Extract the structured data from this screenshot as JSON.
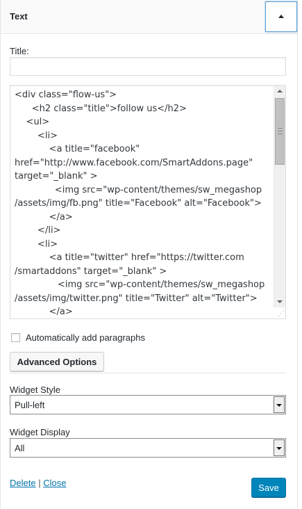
{
  "widget": {
    "title": "Text"
  },
  "form": {
    "title_label": "Title:",
    "title_value": "",
    "content_lines": [
      "<div class=\"flow-us\">",
      "      <h2 class=\"title\">follow us</h2>",
      "    <ul>",
      "        <li>",
      "            <a title=\"facebook\"",
      "href=\"http://www.facebook.com/SmartAddons.page\"",
      "target=\"_blank\" >",
      "              <img src=\"wp-content/themes/sw_megashop",
      "/assets/img/fb.png\" title=\"Facebook\" alt=\"Facebook\">",
      "            </a>",
      "        </li>",
      "        <li>",
      "            <a title=\"twitter\" href=\"https://twitter.com",
      "/smartaddons\" target=\"_blank\" >",
      "               <img src=\"wp-content/themes/sw_megashop",
      "/assets/img/twitter.png\" title=\"Twitter\" alt=\"Twitter\">",
      "            </a>"
    ],
    "autop_label": "Automatically add paragraphs",
    "autop_checked": false,
    "advanced_button": "Advanced Options",
    "style_label": "Widget Style",
    "style_value": "Pull-left",
    "display_label": "Widget Display",
    "display_value": "All"
  },
  "footer": {
    "delete_label": "Delete",
    "separator": "|",
    "close_label": "Close",
    "save_label": "Save"
  },
  "colors": {
    "primary": "#0085ba",
    "link": "#0073aa",
    "focus_border": "#5b9dd9"
  },
  "icons": {
    "toggle": "triangle-up-icon",
    "select_arrow": "triangle-down-icon"
  }
}
